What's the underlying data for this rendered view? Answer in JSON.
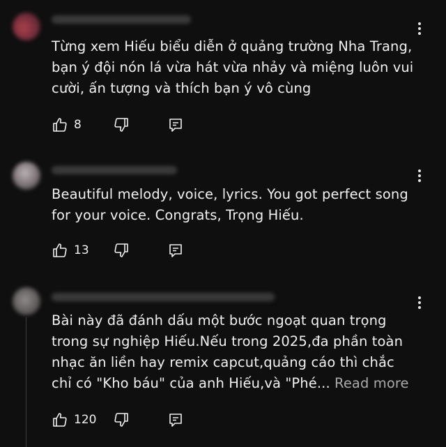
{
  "comments": [
    {
      "text": "Từng xem Hiếu biểu diễn ở quảng trường Nha Trang,\nbạn ý đội nón lá vừa hát vừa nhảy và miệng luôn vui\ncười, ấn tượng và thích bạn ý vô cùng",
      "likes": "8",
      "avatar_color": "#b0404c"
    },
    {
      "text": "Beautiful melody, voice, lyrics. You got perfect song\nfor your voice. Congrats, Trọng Hiếu.",
      "likes": "13",
      "avatar_color": "#9a8f95"
    },
    {
      "text": "Bài này đã đánh dấu một bước ngoạt quan trọng\ntrong sự nghiệp Hiếu.Nếu trong 2025,đa phần toàn\nnhạc ăn liền hay remix capcut,quảng cáo thì chắc\nchỉ có \"Kho báu\" của anh Hiếu,và \"Phé... ",
      "read_more": "Read more",
      "likes": "120",
      "avatar_color": "#8a8585"
    }
  ],
  "icons": {
    "like": "thumbs-up-icon",
    "dislike": "thumbs-down-icon",
    "reply": "reply-icon",
    "more": "more-vertical-icon"
  }
}
